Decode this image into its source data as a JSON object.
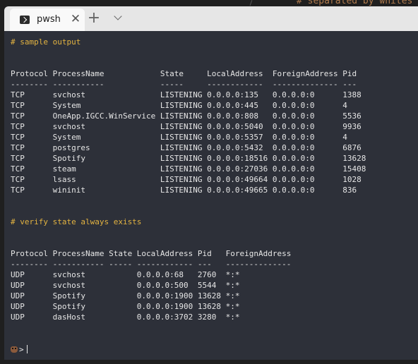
{
  "background_editor": {
    "text": "# separated by whites"
  },
  "tabbar": {
    "tab_title": "pwsh",
    "close_glyph": "✕",
    "new_tab_glyph": "+",
    "tab_icon": "powershell-icon"
  },
  "terminal": {
    "lines": [
      {
        "text": "# sample output",
        "kind": "comment"
      },
      {
        "text": "",
        "kind": "blank"
      },
      {
        "text": "",
        "kind": "blank"
      },
      {
        "text": "Protocol ProcessName            State     LocalAddress  ForeignAddress Pid",
        "kind": "output"
      },
      {
        "text": "-------- -----------            -----     ------------  -------------- ---",
        "kind": "output"
      },
      {
        "text": "TCP      svchost                LISTENING 0.0.0.0:135   0.0.0.0:0      1388",
        "kind": "output"
      },
      {
        "text": "TCP      System                 LISTENING 0.0.0.0:445   0.0.0.0:0      4",
        "kind": "output"
      },
      {
        "text": "TCP      OneApp.IGCC.WinService LISTENING 0.0.0.0:808   0.0.0.0:0      5536",
        "kind": "output"
      },
      {
        "text": "TCP      svchost                LISTENING 0.0.0.0:5040  0.0.0.0:0      9936",
        "kind": "output"
      },
      {
        "text": "TCP      System                 LISTENING 0.0.0.0:5357  0.0.0.0:0      4",
        "kind": "output"
      },
      {
        "text": "TCP      postgres               LISTENING 0.0.0.0:5432  0.0.0.0:0      6876",
        "kind": "output"
      },
      {
        "text": "TCP      Spotify                LISTENING 0.0.0.0:18516 0.0.0.0:0      13628",
        "kind": "output"
      },
      {
        "text": "TCP      steam                  LISTENING 0.0.0.0:27036 0.0.0.0:0      15408",
        "kind": "output"
      },
      {
        "text": "TCP      lsass                  LISTENING 0.0.0.0:49664 0.0.0.0:0      1028",
        "kind": "output"
      },
      {
        "text": "TCP      wininit                LISTENING 0.0.0.0:49665 0.0.0.0:0      836",
        "kind": "output"
      },
      {
        "text": "",
        "kind": "blank"
      },
      {
        "text": "",
        "kind": "blank"
      },
      {
        "text": "# verify state always exists",
        "kind": "comment"
      },
      {
        "text": "",
        "kind": "blank"
      },
      {
        "text": "",
        "kind": "blank"
      },
      {
        "text": "Protocol ProcessName State LocalAddress Pid   ForeignAddress",
        "kind": "output"
      },
      {
        "text": "-------- ----------- ----- ------------ ---   --------------",
        "kind": "output"
      },
      {
        "text": "UDP      svchost           0.0.0.0:68   2760  *:*",
        "kind": "output"
      },
      {
        "text": "UDP      svchost           0.0.0.0:500  5544  *:*",
        "kind": "output"
      },
      {
        "text": "UDP      Spotify           0.0.0.0:1900 13628 *:*",
        "kind": "output"
      },
      {
        "text": "UDP      Spotify           0.0.0.0:1900 13628 *:*",
        "kind": "output"
      },
      {
        "text": "UDP      dasHost           0.0.0.0:3702 3280  *:*",
        "kind": "output"
      }
    ],
    "prompt": {
      "icon": "beaver-prompt-icon",
      "symbol": ">"
    }
  },
  "colors": {
    "terminal_bg": "#2d3039",
    "comment": "#e3b341",
    "text": "#e6e6e6",
    "tabbar_bg": "#e6e6e6",
    "active_tab_bg": "#f9f9f9"
  }
}
